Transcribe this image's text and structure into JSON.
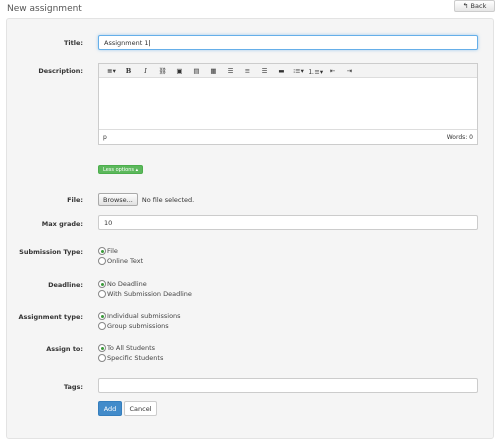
{
  "header": {
    "title": "New assignment",
    "back_label": "Back"
  },
  "form": {
    "title_label": "Title:",
    "title_value": "Assignment 1",
    "description_label": "Description:",
    "editor": {
      "toolbar": [
        "styles-icon",
        "bold-icon",
        "italic-icon",
        "link-icon",
        "image-icon",
        "media-icon",
        "table-icon",
        "align-left-icon",
        "align-center-icon",
        "align-right-icon",
        "justify-icon",
        "bullet-list-icon",
        "numbered-list-icon",
        "outdent-icon",
        "indent-icon"
      ],
      "path": "p",
      "word_count": "Words: 0"
    },
    "less_options_label": "Less options ▴",
    "file_label": "File:",
    "browse_label": "Browse...",
    "no_file_text": "No file selected.",
    "max_grade_label": "Max grade:",
    "max_grade_value": "10",
    "submission_type": {
      "label": "Submission Type:",
      "options": [
        "File",
        "Online Text"
      ],
      "selected": 0
    },
    "deadline": {
      "label": "Deadline:",
      "options": [
        "No Deadline",
        "With Submission Deadline"
      ],
      "selected": 0
    },
    "assignment_type": {
      "label": "Assignment type:",
      "options": [
        "Individual submissions",
        "Group submissions"
      ],
      "selected": 0
    },
    "assign_to": {
      "label": "Assign to:",
      "options": [
        "To All Students",
        "Specific Students"
      ],
      "selected": 0
    },
    "tags_label": "Tags:",
    "tags_value": "",
    "add_label": "Add",
    "cancel_label": "Cancel"
  },
  "colors": {
    "primary": "#428bca",
    "success": "#5cb85c",
    "panel_bg": "#f5f5f5",
    "focus": "#66afe9"
  }
}
